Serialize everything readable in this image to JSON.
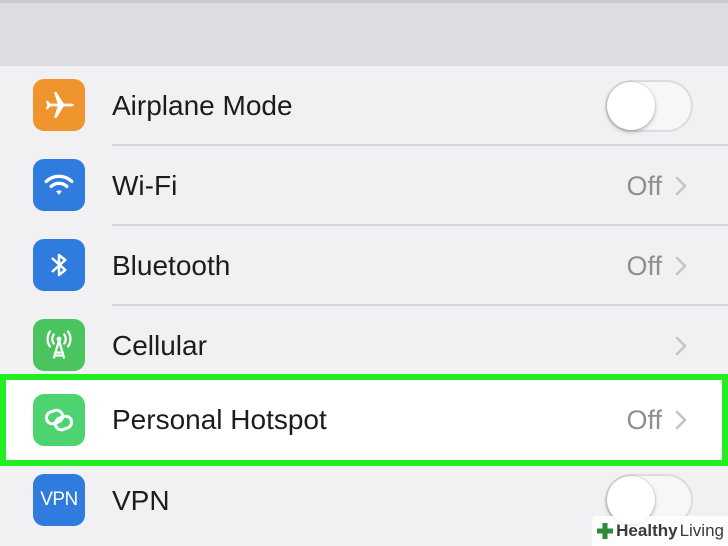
{
  "colors": {
    "highlight_border": "#22ee22",
    "airplane_icon_bg": "#f0952e",
    "wifi_icon_bg": "#2f7bde",
    "bluetooth_icon_bg": "#2f7bde",
    "cellular_icon_bg": "#4bc35e",
    "hotspot_icon_bg": "#4dd470",
    "vpn_icon_bg": "#2f7bde"
  },
  "settings": {
    "rows": [
      {
        "id": "airplane",
        "icon": "airplane-icon",
        "label": "Airplane Mode",
        "control": "toggle",
        "toggle_on": false
      },
      {
        "id": "wifi",
        "icon": "wifi-icon",
        "label": "Wi-Fi",
        "detail": "Off",
        "control": "chevron"
      },
      {
        "id": "bluetooth",
        "icon": "bluetooth-icon",
        "label": "Bluetooth",
        "detail": "Off",
        "control": "chevron"
      },
      {
        "id": "cellular",
        "icon": "cellular-antenna-icon",
        "label": "Cellular",
        "detail": "",
        "control": "chevron"
      },
      {
        "id": "hotspot",
        "icon": "personal-hotspot-icon",
        "label": "Personal Hotspot",
        "detail": "Off",
        "control": "chevron",
        "highlighted": true
      },
      {
        "id": "vpn",
        "icon": "vpn-icon",
        "icon_text": "VPN",
        "label": "VPN",
        "control": "toggle",
        "toggle_on": false
      }
    ]
  },
  "watermark": {
    "part1": "Healthy",
    "part2": "Living"
  }
}
